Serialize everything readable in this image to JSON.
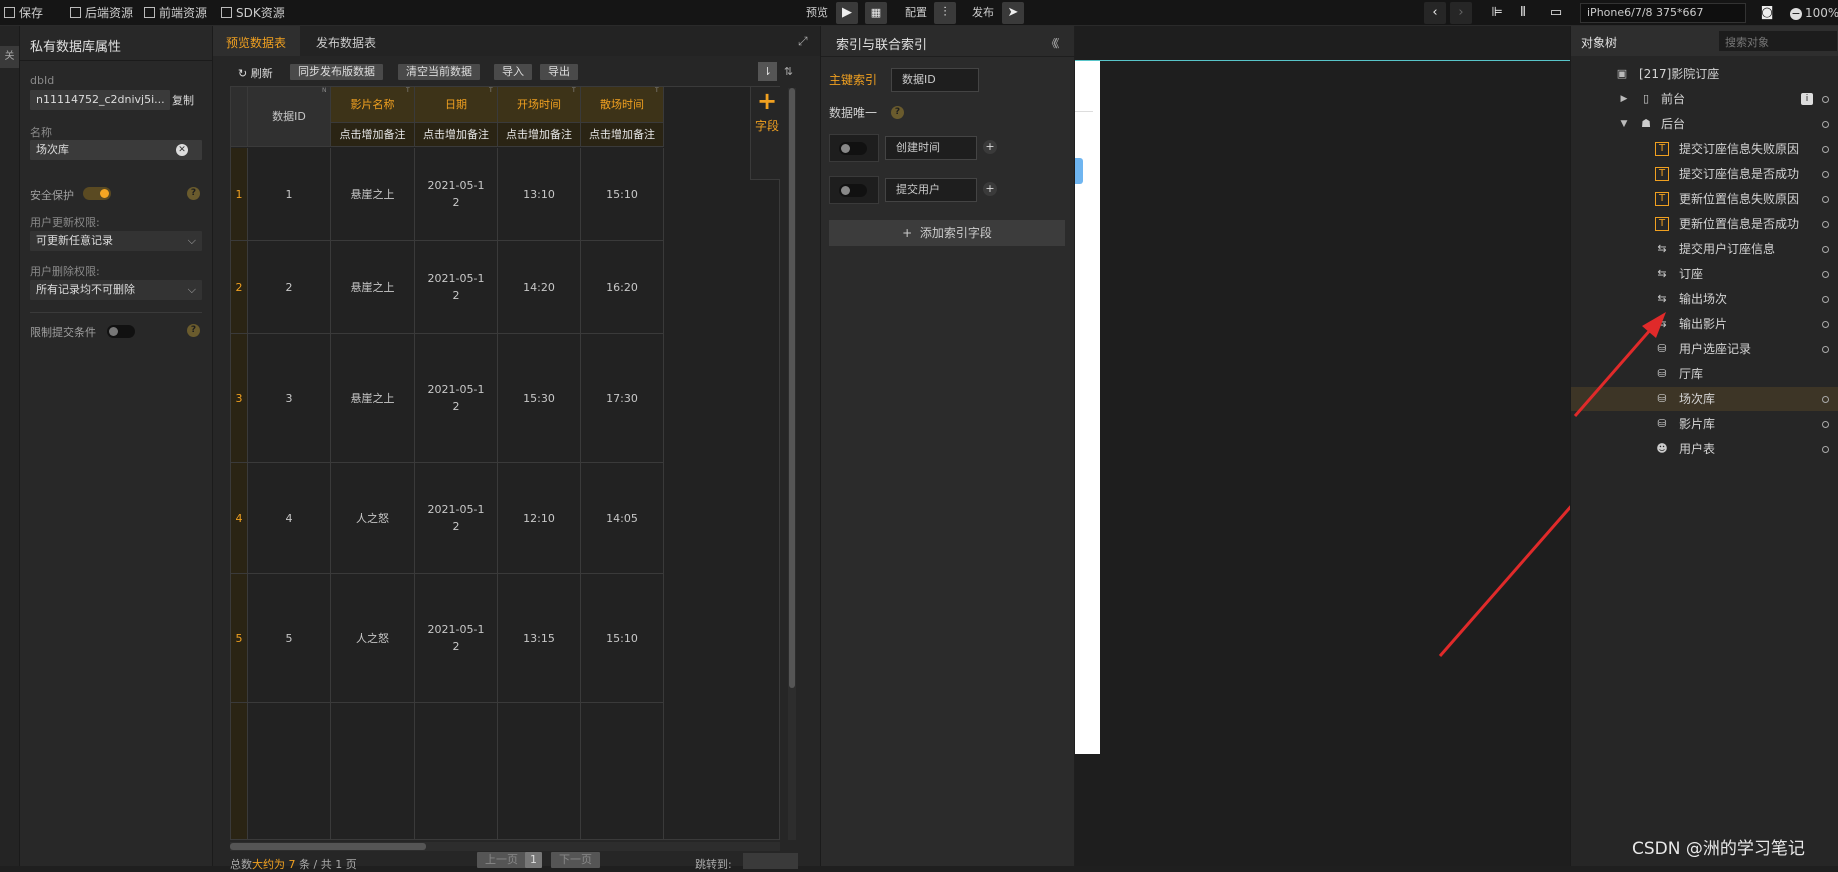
{
  "topbar": {
    "save": "保存",
    "backend_resources": "后端资源",
    "frontend_resources": "前端资源",
    "sdk_resources": "SDK资源",
    "preview": "预览",
    "config": "配置",
    "publish": "发布",
    "device": "iPhone6/7/8 375*667",
    "zoom": "100%"
  },
  "left_strip": {
    "label": "关"
  },
  "left_panel": {
    "title": "私有数据库属性",
    "dbid_label": "dbId",
    "dbid_value": "n11114752_c2dnivj5i...",
    "copy": "复制",
    "name_label": "名称",
    "name_value": "场次库",
    "security": "安全保护",
    "security_on": true,
    "update_perm_label": "用户更新权限:",
    "update_perm_value": "可更新任意记录",
    "delete_perm_label": "用户删除权限:",
    "delete_perm_value": "所有记录均不可删除",
    "limit_submit": "限制提交条件",
    "limit_submit_on": false,
    "help": "?"
  },
  "table_panel": {
    "tab_preview": "预览数据表",
    "tab_publish": "发布数据表",
    "refresh": "刷新",
    "sync": "同步发布版数据",
    "clear": "清空当前数据",
    "import": "导入",
    "export": "导出",
    "add_field": "字段",
    "add_plus": "+",
    "headers": [
      "数据ID",
      "影片名称",
      "日期",
      "开场时间",
      "散场时间"
    ],
    "remark": "点击增加备注",
    "corner_marks": [
      "N",
      "T",
      "T",
      "T",
      "T"
    ],
    "rows": [
      {
        "no": "1",
        "cells": [
          "1",
          "悬崖之上",
          "2021-05-1\n2",
          "13:10",
          "15:10"
        ]
      },
      {
        "no": "2",
        "cells": [
          "2",
          "悬崖之上",
          "2021-05-1\n2",
          "14:20",
          "16:20"
        ]
      },
      {
        "no": "3",
        "cells": [
          "3",
          "悬崖之上",
          "2021-05-1\n2",
          "15:30",
          "17:30"
        ]
      },
      {
        "no": "4",
        "cells": [
          "4",
          "人之怒",
          "2021-05-1\n2",
          "12:10",
          "14:05"
        ]
      },
      {
        "no": "5",
        "cells": [
          "5",
          "人之怒",
          "2021-05-1\n2",
          "13:15",
          "15:10"
        ]
      }
    ],
    "footer_prefix": "总数",
    "footer_count": "大约为 7",
    "footer_suffix": "条 / 共 1 页",
    "prev_page": "上一页",
    "page": "1",
    "next_page": "下一页",
    "jump_to": "跳转到:"
  },
  "index_panel": {
    "title": "索引与联合索引",
    "collapse": "《《",
    "primary_label": "主键索引",
    "primary_value": "数据ID",
    "unique_label": "数据唯一",
    "index_rows": [
      "创建时间",
      "提交用户"
    ],
    "add_index": "添加索引字段",
    "plus": "+"
  },
  "right_panel": {
    "tab": "对象树",
    "search_placeholder": "搜索对象",
    "root": "[217]影院订座",
    "nodes": [
      {
        "label": "前台",
        "icon": "phone-icon",
        "indent": 1,
        "expand": "▶",
        "selected": false,
        "info": true
      },
      {
        "label": "后台",
        "icon": "server-icon",
        "indent": 1,
        "expand": "▼",
        "selected": false,
        "info": false
      },
      {
        "label": "提交订座信息失败原因",
        "icon": "text-variable-icon",
        "indent": 2,
        "selected": false
      },
      {
        "label": "提交订座信息是否成功",
        "icon": "text-variable-icon",
        "indent": 2,
        "selected": false
      },
      {
        "label": "更新位置信息失败原因",
        "icon": "text-variable-icon",
        "indent": 2,
        "selected": false
      },
      {
        "label": "更新位置信息是否成功",
        "icon": "text-variable-icon",
        "indent": 2,
        "selected": false
      },
      {
        "label": "提交用户订座信息",
        "icon": "transfer-icon",
        "indent": 2,
        "selected": false
      },
      {
        "label": "订座",
        "icon": "transfer-icon",
        "indent": 2,
        "selected": false
      },
      {
        "label": "输出场次",
        "icon": "transfer-icon",
        "indent": 2,
        "selected": false
      },
      {
        "label": "输出影片",
        "icon": "transfer-icon",
        "indent": 2,
        "selected": false
      },
      {
        "label": "用户选座记录",
        "icon": "database-icon",
        "indent": 2,
        "selected": false
      },
      {
        "label": "厅库",
        "icon": "database-icon",
        "indent": 2,
        "selected": false,
        "nodot": true
      },
      {
        "label": "场次库",
        "icon": "database-icon",
        "indent": 2,
        "selected": true
      },
      {
        "label": "影片库",
        "icon": "database-icon",
        "indent": 2,
        "selected": false
      },
      {
        "label": "用户表",
        "icon": "user-icon",
        "indent": 2,
        "selected": false
      }
    ]
  },
  "watermark": "CSDN @洲的学习笔记",
  "colors": {
    "accent": "#f0a020",
    "arrow": "#e02a2a",
    "selected_row": "#3d3526"
  }
}
